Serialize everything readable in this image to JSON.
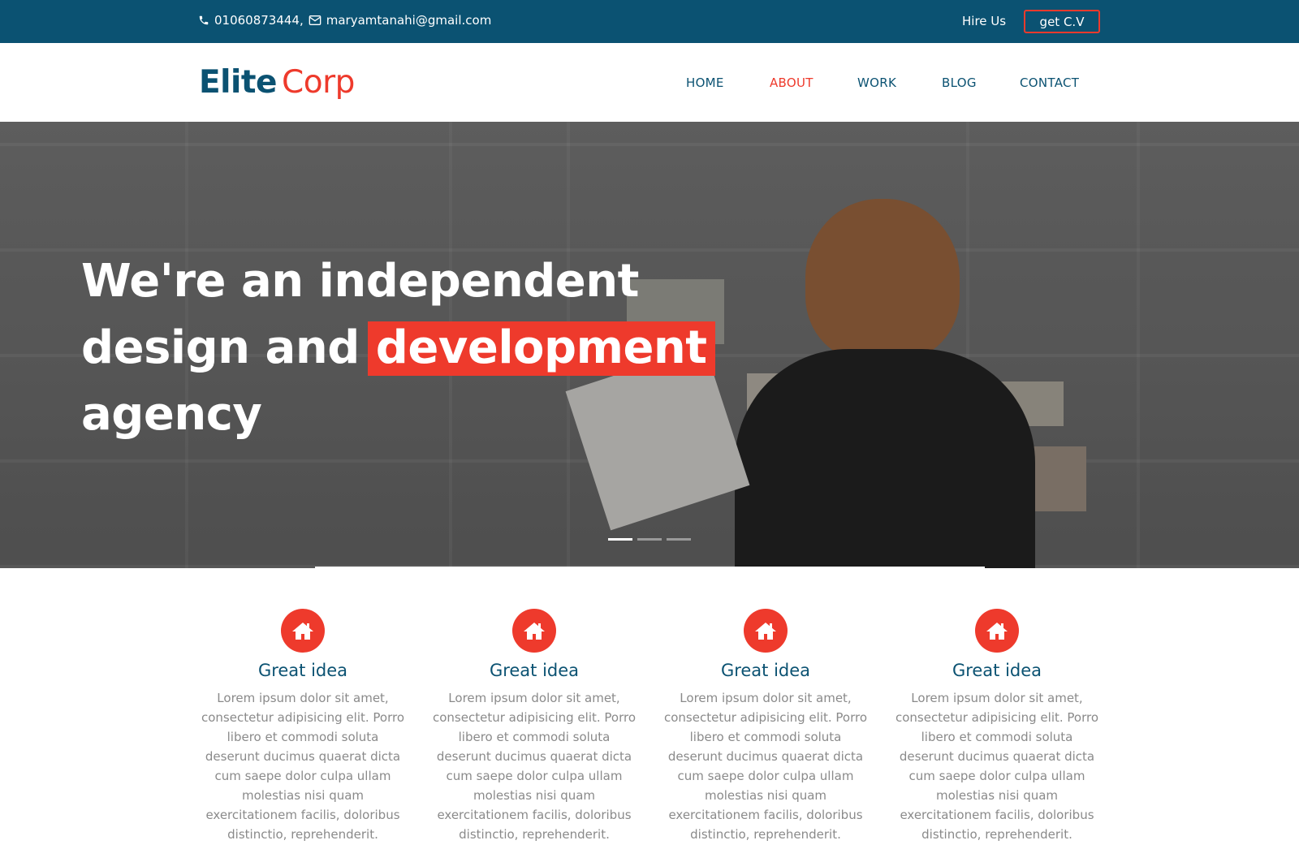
{
  "topbar": {
    "phone_icon": "phone-icon",
    "contact_text": "01060873444,",
    "mail_icon": "envelope-icon",
    "email": "maryamtanahi@gmail.com",
    "hire_label": "Hire Us",
    "cv_label": "get C.V"
  },
  "header": {
    "logo_part1": "Elite",
    "logo_part2": "Corp",
    "nav": [
      "HOME",
      "ABOUT",
      "WORK",
      "BLOG",
      "CONTACT"
    ],
    "active_nav": "ABOUT"
  },
  "hero": {
    "line1": "We're an independent",
    "line2_pre": "design and",
    "line2_highlight": "development",
    "line3": "agency",
    "slides": 3,
    "active_slide": 1
  },
  "features": [
    {
      "icon": "home-icon",
      "title": "Great idea",
      "text": "Lorem ipsum dolor sit amet, consectetur adipisicing elit. Porro libero et commodi soluta deserunt ducimus quaerat dicta cum saepe dolor culpa ullam molestias nisi quam exercitationem facilis, doloribus distinctio, reprehenderit."
    },
    {
      "icon": "home-icon",
      "title": "Great idea",
      "text": "Lorem ipsum dolor sit amet, consectetur adipisicing elit. Porro libero et commodi soluta deserunt ducimus quaerat dicta cum saepe dolor culpa ullam molestias nisi quam exercitationem facilis, doloribus distinctio, reprehenderit."
    },
    {
      "icon": "home-icon",
      "title": "Great idea",
      "text": "Lorem ipsum dolor sit amet, consectetur adipisicing elit. Porro libero et commodi soluta deserunt ducimus quaerat dicta cum saepe dolor culpa ullam molestias nisi quam exercitationem facilis, doloribus distinctio, reprehenderit."
    },
    {
      "icon": "home-icon",
      "title": "Great idea",
      "text": "Lorem ipsum dolor sit amet, consectetur adipisicing elit. Porro libero et commodi soluta deserunt ducimus quaerat dicta cum saepe dolor culpa ullam molestias nisi quam exercitationem facilis, doloribus distinctio, reprehenderit."
    }
  ],
  "colors": {
    "primary": "#0b5272",
    "accent": "#ee3a2c",
    "body_text": "#8a8a8a"
  }
}
